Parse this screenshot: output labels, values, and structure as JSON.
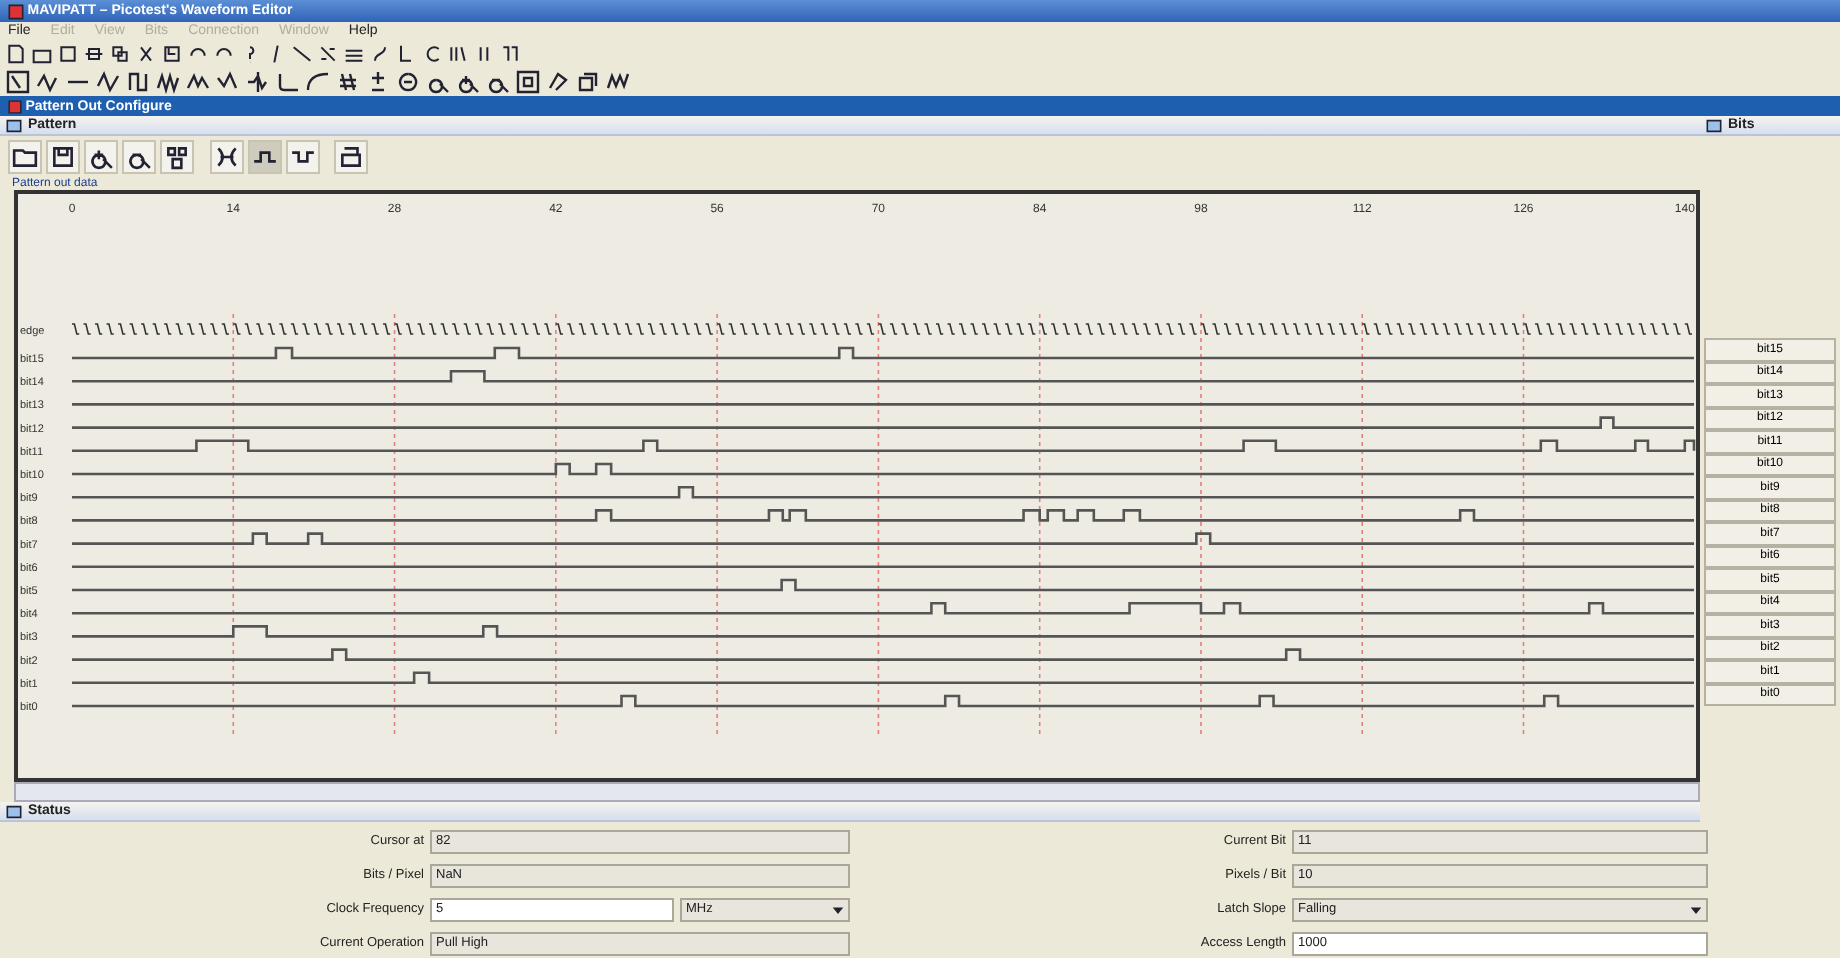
{
  "window": {
    "title": "MAVIPATT – Picotest's Waveform Editor"
  },
  "menu": [
    {
      "label": "File",
      "disabled": false
    },
    {
      "label": "Edit",
      "disabled": true
    },
    {
      "label": "View",
      "disabled": true
    },
    {
      "label": "Bits",
      "disabled": true
    },
    {
      "label": "Connection",
      "disabled": true
    },
    {
      "label": "Window",
      "disabled": true
    },
    {
      "label": "Help",
      "disabled": false
    }
  ],
  "child_window": {
    "title": "Pattern Out Configure"
  },
  "pattern_panel": {
    "title": "Pattern",
    "data_label": "Pattern out data",
    "waveform": {
      "ticks": [
        "0",
        "14",
        "28",
        "42",
        "56",
        "70",
        "84",
        "98",
        "112",
        "126",
        "140"
      ],
      "edge_label": "edge",
      "signals": [
        "bit15",
        "bit14",
        "bit13",
        "bit12",
        "bit11",
        "bit10",
        "bit9",
        "bit8",
        "bit7",
        "bit6",
        "bit5",
        "bit4",
        "bit3",
        "bit2",
        "bit1",
        "bit0"
      ]
    }
  },
  "bits_panel": {
    "title": "Bits",
    "buttons": [
      "bit15",
      "bit14",
      "bit13",
      "bit12",
      "bit11",
      "bit10",
      "bit9",
      "bit8",
      "bit7",
      "bit6",
      "bit5",
      "bit4",
      "bit3",
      "bit2",
      "bit1",
      "bit0"
    ]
  },
  "status_panel": {
    "title": "Status",
    "fields": [
      {
        "label": "Cursor at",
        "value": "82",
        "kind": "readonly"
      },
      {
        "label": "Current Bit",
        "value": "11",
        "kind": "readonly"
      },
      {
        "label": "Bits / Pixel",
        "value": "NaN",
        "kind": "readonly"
      },
      {
        "label": "Pixels / Bit",
        "value": "10",
        "kind": "readonly"
      },
      {
        "label": "Clock Frequency",
        "value": "5",
        "unit": "MHz",
        "kind": "input-unit"
      },
      {
        "label": "Latch Slope",
        "value": "Falling",
        "kind": "select"
      },
      {
        "label": "Current Operation",
        "value": "Pull High",
        "kind": "readonly"
      },
      {
        "label": "Access Length",
        "value": "1000",
        "kind": "input"
      }
    ]
  }
}
